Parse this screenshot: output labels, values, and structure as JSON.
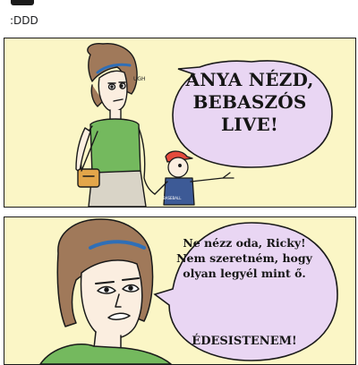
{
  "post": {
    "caption": ":DDD"
  },
  "panel1": {
    "speech": "ANYA NÉZD,\nBEBASZÓS\nLIVE!",
    "sound": "UGH",
    "shirt_text": "BASEBALL"
  },
  "panel2": {
    "speech": "Ne nézz oda, Ricky!\nNem szeretném, hogy\nolyan legyél mint ő.",
    "exclaim": "ÉDESISTENEM!"
  }
}
